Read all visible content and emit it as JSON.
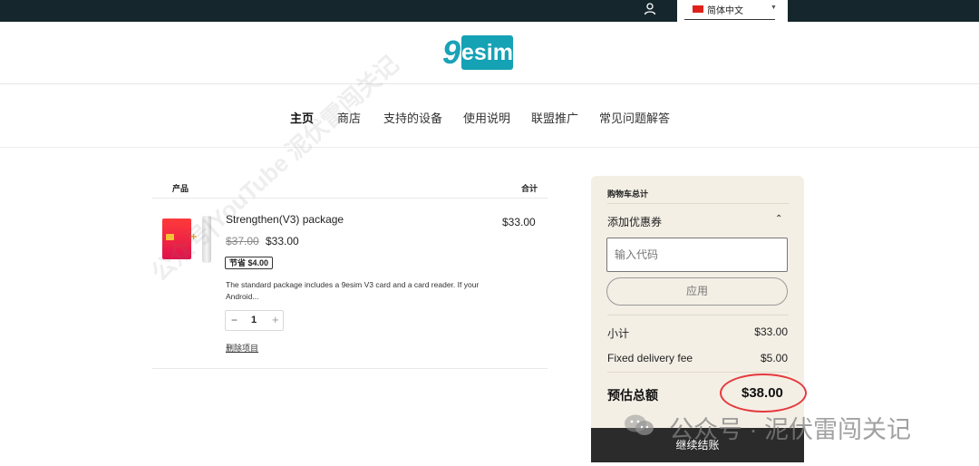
{
  "language": {
    "label": "简体中文"
  },
  "logo": {
    "nine": "9",
    "text": "esim"
  },
  "nav": [
    "主页",
    "商店",
    "支持的设备",
    "使用说明",
    "联盟推广",
    "常见问题解答"
  ],
  "table": {
    "col_product": "产品",
    "col_total": "合计"
  },
  "item": {
    "name": "Strengthen(V3) package",
    "old_price": "$37.00",
    "price": "$33.00",
    "badge": "节省 $4.00",
    "description": "The standard package includes a 9esim V3 card and a card reader. If your Android...",
    "qty": "1",
    "qty_minus": "−",
    "qty_plus": "+",
    "remove": "删除项目",
    "line_total": "$33.00"
  },
  "cart": {
    "title": "购物车总计",
    "coupon_label": "添加优惠券",
    "coupon_placeholder": "输入代码",
    "apply": "应用",
    "subtotal_label": "小计",
    "subtotal": "$33.00",
    "fee_label": "Fixed delivery fee",
    "fee": "$5.00",
    "total_label": "预估总额",
    "total": "$38.00",
    "checkout": "继续结账"
  },
  "watermark": "公众号|YouTube 泥伏雷闯关记",
  "overlay": "公众号 · 泥伏雷闯关记",
  "colors": {
    "topbar": "#16262d",
    "brand": "#15a2b5",
    "panel": "#f4efe5",
    "highlight": "#e5393d",
    "checkout": "#2b2b2b"
  }
}
